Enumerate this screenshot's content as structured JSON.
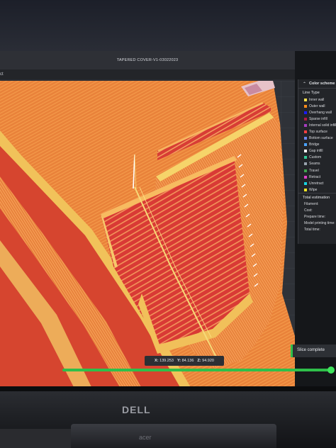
{
  "window": {
    "title": "TAPERED COVER-V1-03022023",
    "menu_fragment": "ct"
  },
  "panel": {
    "title": "Color scheme",
    "line_type_label": "Line Type",
    "legend": [
      {
        "label": "Inner wall",
        "color": "#ffe14d"
      },
      {
        "label": "Outer wall",
        "color": "#ff8c1a"
      },
      {
        "label": "Overhang wall",
        "color": "#1a1aff"
      },
      {
        "label": "Sparse infill",
        "color": "#b31a3d"
      },
      {
        "label": "Internal solid infill",
        "color": "#a63dbf"
      },
      {
        "label": "Top surface",
        "color": "#ff4040"
      },
      {
        "label": "Bottom surface",
        "color": "#6b87f0"
      },
      {
        "label": "Bridge",
        "color": "#4aa3ff"
      },
      {
        "label": "Gap infill",
        "color": "#ffffff"
      },
      {
        "label": "Custom",
        "color": "#33cc99"
      },
      {
        "label": "Seams",
        "color": "#99a3ad"
      },
      {
        "label": "Travel",
        "color": "#3fa34d"
      },
      {
        "label": "Retract",
        "color": "#e040c8"
      },
      {
        "label": "Unretract",
        "color": "#19d4e0"
      },
      {
        "label": "Wipe",
        "color": "#f0e526"
      }
    ],
    "estimation_label": "Total estimation",
    "estimation_rows": [
      "Filament:",
      "Cost:",
      "Prepare time:",
      "Model printing time:",
      "Total time:"
    ]
  },
  "coords": {
    "x_label": "X:",
    "x": "139.253",
    "y_label": "Y:",
    "y": "84.136",
    "z_label": "Z:",
    "z": "94.920"
  },
  "status": {
    "toast": "Slice complete"
  },
  "slider": {
    "position": 1.0
  },
  "hardware": {
    "monitor_brand": "DELL",
    "laptop_brand": "acer"
  }
}
